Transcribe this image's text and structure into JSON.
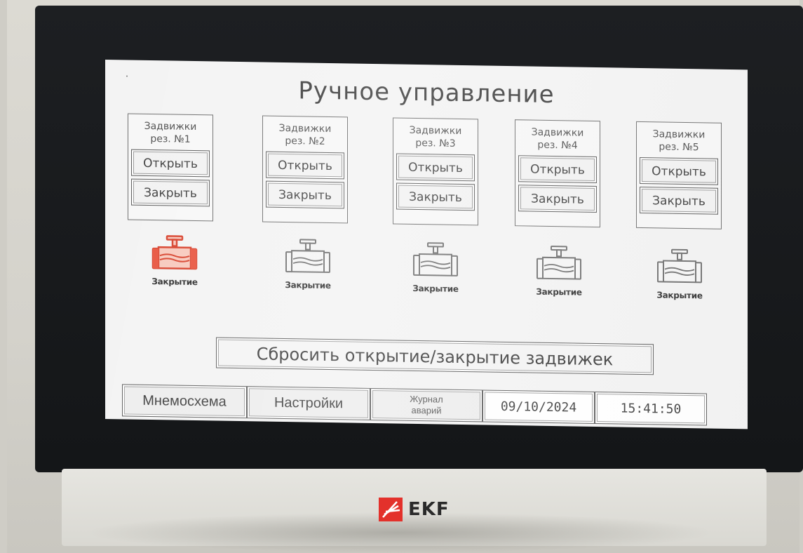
{
  "screen": {
    "title": "Ручное управление"
  },
  "gates": [
    {
      "title_line1": "Задвижки",
      "title_line2": "рез. №1",
      "open_label": "Открыть",
      "close_label": "Закрыть",
      "status": "Закрытие",
      "highlighted": true
    },
    {
      "title_line1": "Задвижки",
      "title_line2": "рез. №2",
      "open_label": "Открыть",
      "close_label": "Закрыть",
      "status": "Закрытие",
      "highlighted": false
    },
    {
      "title_line1": "Задвижки",
      "title_line2": "рез. №3",
      "open_label": "Открыть",
      "close_label": "Закрыть",
      "status": "Закрытие",
      "highlighted": false
    },
    {
      "title_line1": "Задвижки",
      "title_line2": "рез. №4",
      "open_label": "Открыть",
      "close_label": "Закрыть",
      "status": "Закрытие",
      "highlighted": false
    },
    {
      "title_line1": "Задвижки",
      "title_line2": "рез. №5",
      "open_label": "Открыть",
      "close_label": "Закрыть",
      "status": "Закрытие",
      "highlighted": false
    }
  ],
  "reset_button": "Сбросить открытие/закрытие задвижек",
  "navbar": {
    "mnemo": "Мнемосхема",
    "settings": "Настройки",
    "alarm_log_line1": "Журнал",
    "alarm_log_line2": "аварий",
    "date": "09/10/2024",
    "time": "15:41:50"
  },
  "device": {
    "brand": "EKF",
    "brand_color": "#e3312b"
  },
  "colors": {
    "valve_active": "#e8553f",
    "valve_inactive": "#7a7a7a"
  },
  "icons": {
    "valve": "valve-icon"
  }
}
